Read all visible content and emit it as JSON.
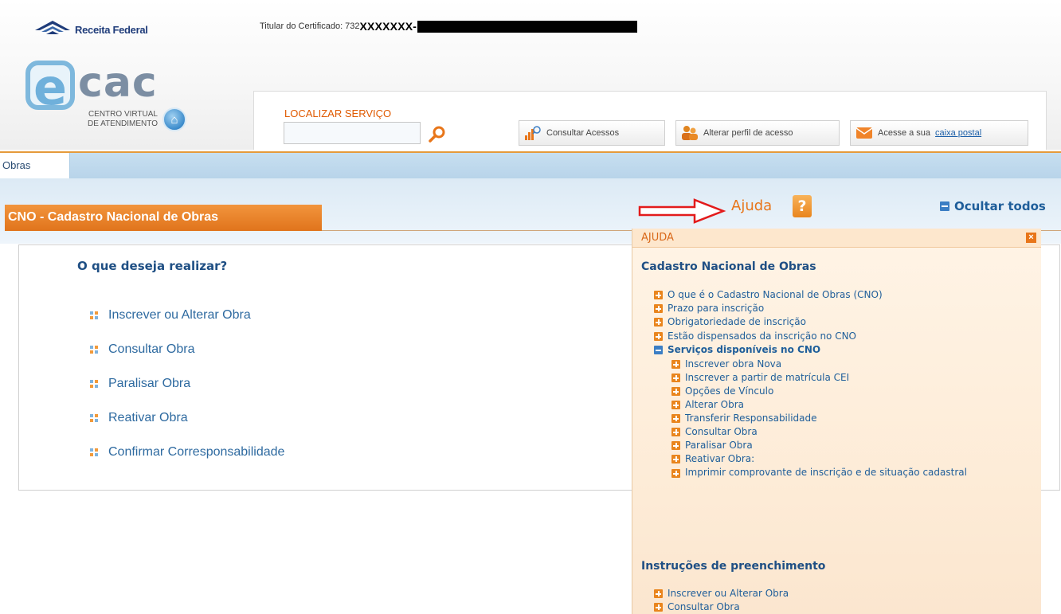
{
  "header": {
    "receita_text": "Receita Federal",
    "cert_label": "Titular do Certificado:",
    "cert_number": "732",
    "cert_mask": "XXXXXXX-",
    "ecac_e": "e",
    "ecac_cac": "cac",
    "ecac_line1": "CENTRO VIRTUAL",
    "ecac_line2": "DE ATENDIMENTO",
    "localizar_label": "LOCALIZAR SERVIÇO",
    "search_value": "",
    "btn_acessos": "Consultar Acessos",
    "btn_perfil": "Alterar perfil de acesso",
    "btn_caixa_prefix": "Acesse a sua",
    "btn_caixa_link": "caixa postal"
  },
  "menu": {
    "obras": "Obras"
  },
  "page": {
    "title": "CNO - Cadastro Nacional de Obras",
    "ajuda": "Ajuda",
    "ajuda_icon": "?",
    "ocultar": "Ocultar todos",
    "question": "O que deseja realizar?",
    "options": [
      "Inscrever ou Alterar Obra",
      "Consultar Obra",
      "Paralisar Obra",
      "Reativar Obra",
      "Confirmar Corresponsabilidade"
    ]
  },
  "help": {
    "title": "AJUDA",
    "close": "×",
    "section1": "Cadastro Nacional de Obras",
    "items": [
      "O que é o Cadastro Nacional de Obras (CNO)",
      "Prazo para inscrição",
      "Obrigatoriedade de inscrição",
      "Estão dispensados da inscrição no CNO"
    ],
    "expanded": "Serviços disponíveis no CNO",
    "subitems": [
      "Inscrever obra Nova",
      "Inscrever a partir de matrícula CEI",
      "Opções de Vínculo",
      "Alterar Obra",
      "Transferir Responsabilidade",
      "Consultar Obra",
      "Paralisar Obra",
      "Reativar Obra:",
      "Imprimir comprovante de inscrição e de situação cadastral"
    ],
    "section2": "Instruções de preenchimento",
    "items2": [
      "Inscrever ou Alterar Obra",
      "Consultar Obra"
    ]
  },
  "colors": {
    "orange": "#e8761a",
    "blue_link": "#2e6aa0",
    "heading_blue": "#1f4f84"
  }
}
